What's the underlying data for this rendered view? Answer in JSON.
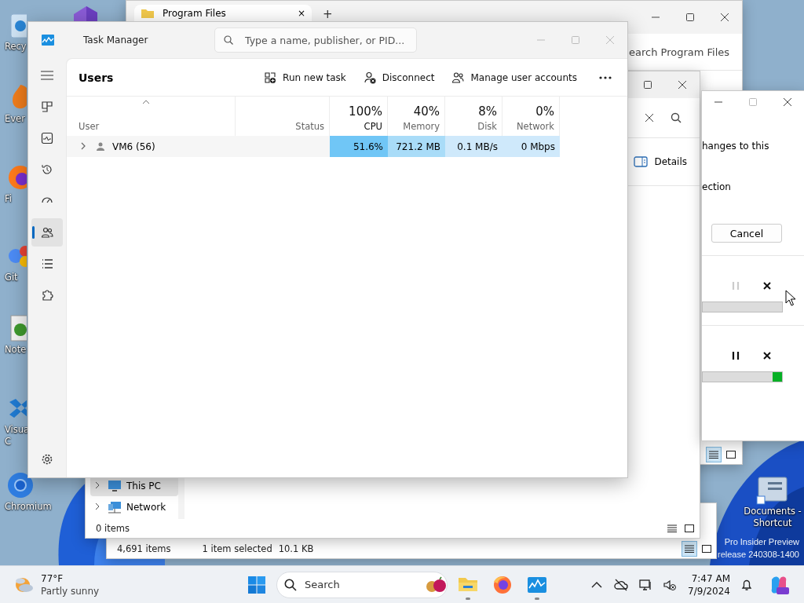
{
  "desktop": {
    "icons_left": [
      {
        "lines": [
          "Recy"
        ]
      },
      {
        "lines": [
          "Ever"
        ]
      },
      {
        "lines": [
          "Fi"
        ]
      },
      {
        "lines": [
          "Git"
        ]
      },
      {
        "lines": [
          "Note"
        ]
      },
      {
        "lines": [
          "Visua",
          "C"
        ]
      },
      {
        "lines": [
          "Chromium"
        ]
      }
    ],
    "icons_right": [
      {
        "lines": [
          "Documents -",
          "Shortcut"
        ]
      }
    ],
    "watermark": [
      "Pro Insider Preview",
      "release 240308-1400"
    ]
  },
  "explorer_back": {
    "tab_title": "Program Files",
    "tab_close": "×",
    "new_tab": "+",
    "search": "earch Program Files"
  },
  "explorer_bottom": {
    "status": [
      "4,691 items",
      "1 item selected",
      "10.1 KB"
    ]
  },
  "explorer_front": {
    "details": "Details",
    "nav": [
      {
        "label": "This PC",
        "selected": true
      },
      {
        "label": "Network",
        "selected": false
      }
    ],
    "status": "0 items"
  },
  "copy_dialog": {
    "texts": [
      "hanges to this",
      "ection"
    ],
    "cancel": "Cancel",
    "transfers": [
      {
        "pause_enabled": false,
        "kind": "idle"
      },
      {
        "pause_enabled": true,
        "kind": "busy"
      }
    ]
  },
  "task_manager": {
    "title": "Task Manager",
    "search": {
      "placeholder": "Type a name, publisher, or PID..."
    },
    "nav": [
      {
        "selected": false
      },
      {
        "selected": false
      },
      {
        "selected": false
      },
      {
        "selected": false
      },
      {
        "selected": true
      },
      {
        "selected": false
      },
      {
        "selected": false
      }
    ],
    "page_title": "Users",
    "commands": [
      "Run new task",
      "Disconnect",
      "Manage user accounts"
    ],
    "columns": [
      {
        "label": "User",
        "sorted": true
      },
      {
        "label": "Status",
        "sorted": false
      },
      {
        "label": "CPU",
        "usage": "100%",
        "sorted": false
      },
      {
        "label": "Memory",
        "usage": "40%",
        "sorted": false
      },
      {
        "label": "Disk",
        "usage": "8%",
        "sorted": false
      },
      {
        "label": "Network",
        "usage": "0%",
        "sorted": false
      }
    ],
    "rows": [
      {
        "expanded": false,
        "cells": [
          {
            "text": "VM6 (56)"
          },
          {
            "text": ""
          },
          {
            "text": "51.6%",
            "color": "#70c6f6"
          },
          {
            "text": "721.2 MB",
            "color": "#a9dcf8"
          },
          {
            "text": "0.1 MB/s",
            "color": "#cfe9fb"
          },
          {
            "text": "0 Mbps",
            "color": "#cfe9fb"
          }
        ]
      }
    ]
  },
  "taskbar": {
    "weather": {
      "temp": "77°F",
      "condition": "Partly sunny"
    },
    "search": "Search",
    "apps": [
      {
        "running": true
      },
      {
        "running": false
      },
      {
        "running": true
      }
    ],
    "time": "7:47 AM",
    "date": "7/9/2024"
  }
}
